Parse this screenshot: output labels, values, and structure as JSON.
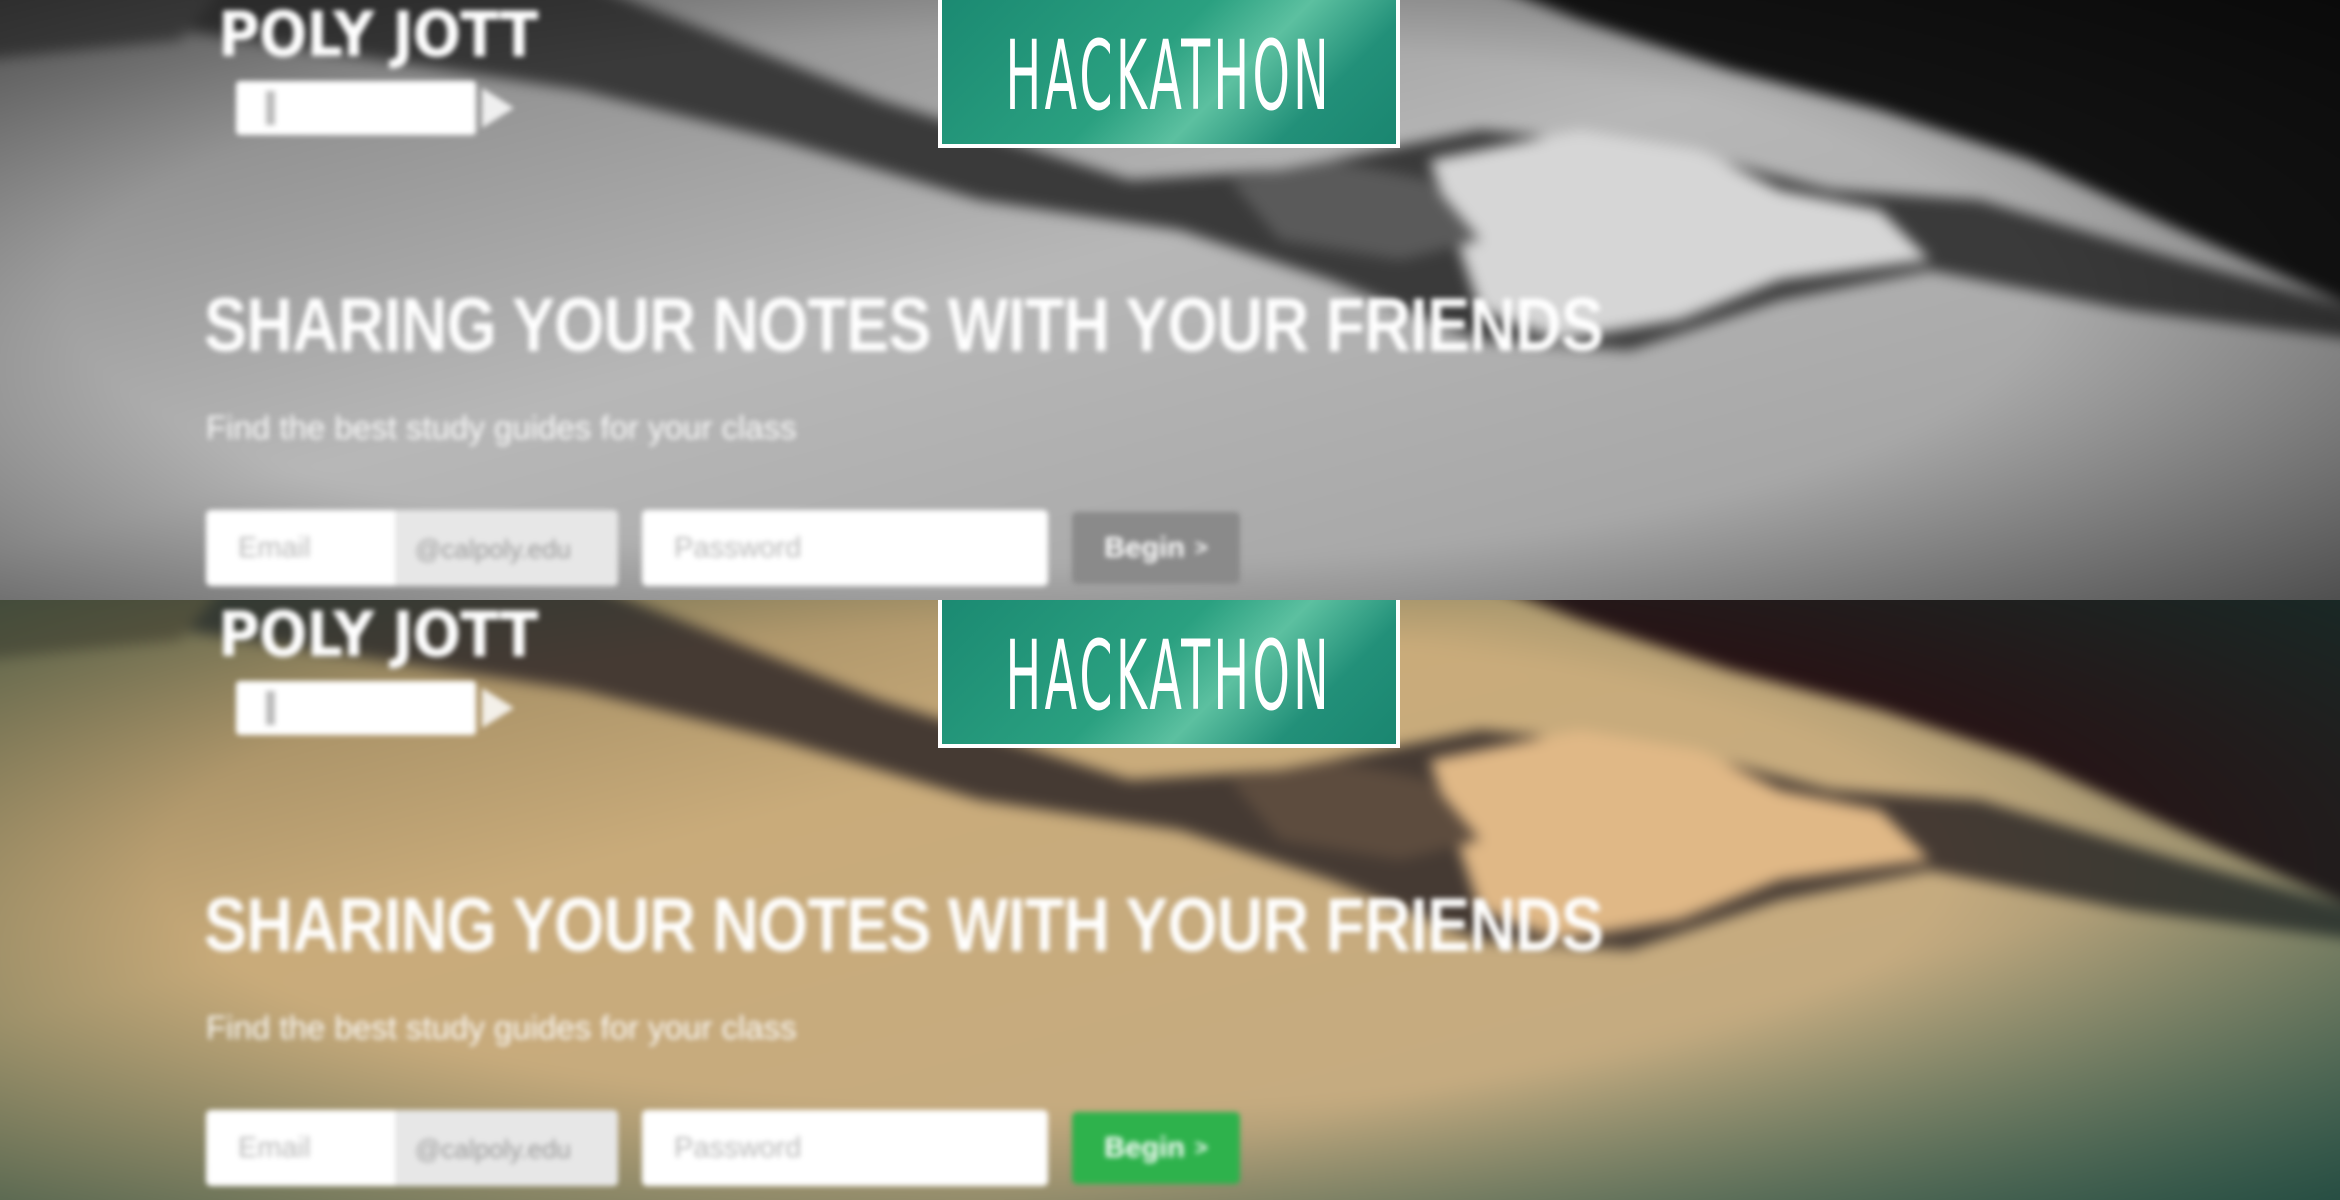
{
  "app": {
    "logo_text": "POLY JOTT",
    "badge_text": "HACKATHON",
    "headline": "SHARING YOUR NOTES WITH YOUR FRIENDS",
    "subheadline": "Find the best study guides for your class",
    "form": {
      "email_placeholder": "Email",
      "email_domain": "@calpoly.edu",
      "password_placeholder": "Password",
      "begin_label": "Begin",
      "begin_arrow": ">"
    }
  },
  "panels": [
    {
      "variant": "grayscale",
      "button_color": "#8a8a8a"
    },
    {
      "variant": "color",
      "button_color": "#2eb24c"
    }
  ],
  "colors": {
    "badge": "#229079",
    "accent_green": "#2eb24c",
    "text": "#ffffff"
  }
}
